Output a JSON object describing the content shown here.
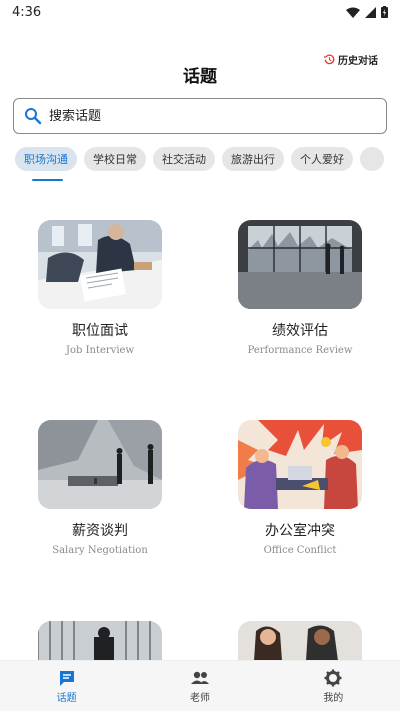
{
  "status_bar": {
    "time": "4:36"
  },
  "header": {
    "title": "话题",
    "history_label": "历史对话"
  },
  "search": {
    "placeholder": "搜索话题"
  },
  "tabs": [
    {
      "label": "职场沟通",
      "active": true
    },
    {
      "label": "学校日常",
      "active": false
    },
    {
      "label": "社交活动",
      "active": false
    },
    {
      "label": "旅游出行",
      "active": false
    },
    {
      "label": "个人爱好",
      "active": false
    },
    {
      "label": "",
      "active": false
    }
  ],
  "topics": [
    {
      "zh": "职位面试",
      "en": "Job Interview"
    },
    {
      "zh": "绩效评估",
      "en": "Performance Review"
    },
    {
      "zh": "薪资谈判",
      "en": "Salary Negotiation"
    },
    {
      "zh": "办公室冲突",
      "en": "Office Conflict"
    },
    {
      "zh": "",
      "en": ""
    },
    {
      "zh": "",
      "en": ""
    }
  ],
  "bottom_nav": [
    {
      "label": "话题",
      "icon": "chat-icon",
      "active": true
    },
    {
      "label": "老师",
      "icon": "people-icon",
      "active": false
    },
    {
      "label": "我的",
      "icon": "gear-icon",
      "active": false
    }
  ],
  "colors": {
    "accent": "#1976d2"
  }
}
